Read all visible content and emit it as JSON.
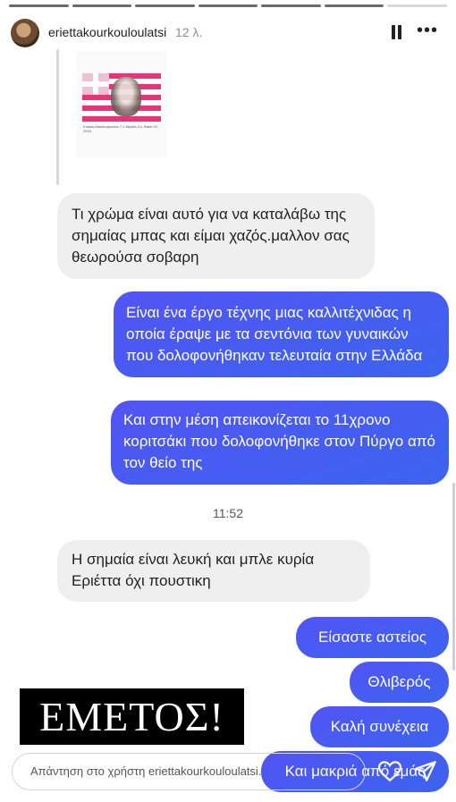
{
  "story": {
    "username": "eriettakourkouloulatsi",
    "time_ago": "12 λ."
  },
  "thumbnail": {
    "caption": "Kostas Mandoupoulos 7-1 Mystra Co. Base 03, 2024"
  },
  "messages": [
    {
      "side": "received",
      "text": "Τι χρώμα είναι αυτό για να καταλάβω της σημαίας μπας και είμαι χαζός.μαλλον σας θεωρούσα σοβαρη"
    },
    {
      "side": "sent",
      "text": "Είναι ένα έργο τέχνης μιας καλλιτέχνιδας η οποία έραψε με τα σεντόνια των γυναικών που δολοφονήθηκαν τελευταία στην Ελλάδα"
    },
    {
      "side": "sent",
      "text": "Και στην μέση απεικονίζεται το 11χρονο κοριτσάκι που δολοφονήθηκε στον Πύργο από τον θείο της"
    },
    {
      "side": "received",
      "text": "Η σημαία είναι λευκή και μπλε κυρία Εριέττα όχι πουστικη"
    },
    {
      "side": "sent",
      "text": "Είσαστε αστείος"
    },
    {
      "side": "sent",
      "text": "Θλιβερός"
    },
    {
      "side": "sent",
      "text": "Καλή συνέχεια"
    },
    {
      "side": "sent",
      "text": "Και μακριά από εμάς"
    }
  ],
  "timestamp": "11:52",
  "sticker": {
    "text": "ΕΜΕΤΟΣ!"
  },
  "reply": {
    "placeholder": "Απάντηση στο χρήστη eriettakourkouloulatsi..."
  },
  "icons": {
    "pause": "pause-icon",
    "more": "more-options-icon",
    "like": "heart-icon",
    "send": "send-icon"
  },
  "colors": {
    "sent_bubble": "#4a5af2",
    "received_bubble": "#efefef"
  }
}
